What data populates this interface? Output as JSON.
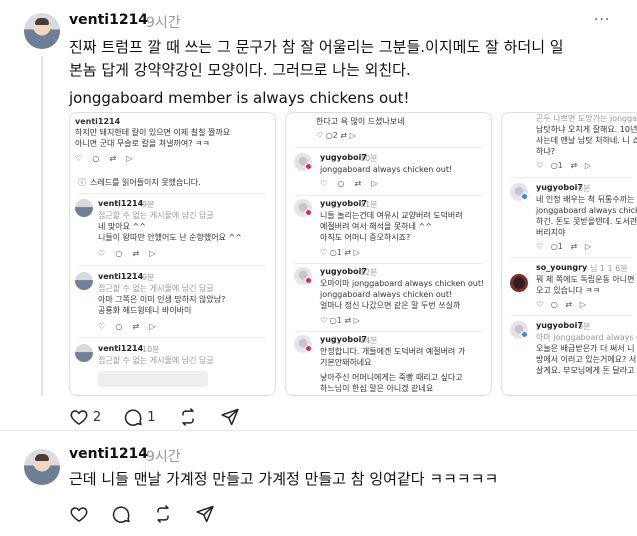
{
  "post1": {
    "username": "venti1214",
    "time": "9시간",
    "more": "···",
    "text_line1": "진짜 트럼프 깔 때 쓰는 그 문구가 참 잘 어울리는 그분들.이지메도 잘 하더니 일",
    "text_line2": "본놈 답게 강약약강인 모양이다. 그러므로 나는 외친다.",
    "text_line3": "jonggaboard member is always chickens out!",
    "likes": "2",
    "comments": "1",
    "screenshots": {
      "card1": {
        "i1_name": "venti1214",
        "i1_l1": "하지만 돼지한테 칼이 있으면 이제 칠칠 짤까요",
        "i1_l2": "아니면 군대 무슬로 칼을 쳐낼까여? ㅋㅋ",
        "i1_notice": "스레드를 읽어들이지 못했습니다.",
        "i2_name": "venti1214",
        "i2_time": "9분",
        "i2_grey": "접근할 수 없는 게시물에 남긴 답글",
        "i2_l1": "네 맞아요 ^^",
        "i2_l2": "니들이 왕따만 안했어도 난 순항했어요 ^^",
        "i3_name": "venti1214",
        "i3_time": "9분",
        "i3_grey": "접근할 수 없는 게시물에 남긴 답글",
        "i3_l1": "아마 그쪽은 이미 인생 망하지 않았남?",
        "i3_l2": "공룡화 헤드윙테니 바이바이",
        "i4_name": "venti1214",
        "i4_time": "10분",
        "i4_grey": "접근할 수 없는 게시물에 남긴 답글"
      },
      "card2": {
        "top_l1": "한다고 욕 많이 드셨나보네",
        "top_icons": "♡  ○2  ⇄  ▷",
        "i1_name": "yugyoboi7",
        "i1_time": "10분",
        "i1_l1": "jonggaboard always chicken out!",
        "i2_name": "yugyoboi7",
        "i2_time": "11분",
        "i2_l1": "니들 놀리는건데 여유시 교양버려 도덕버려",
        "i2_l2": "예절버려 여서 해석을 못하네 ^^",
        "i2_l3": "아직도 어머니 증오하시죠?",
        "i2_icons": "♡  ○1  ⇄  ▷",
        "i3_name": "yugyoboi7",
        "i3_time": "12분",
        "i3_l1": "오마이마 jonggaboard always chicken out!",
        "i3_l2": "jonggaboard always chicken out!",
        "i3_l3": "얼마나 정신 나갔으면 같은 말 두번 쓰실까",
        "i3_icons": "♡  ○1  ⇄  ▷",
        "i4_name": "yugyoboi7",
        "i4_time": "14분",
        "i4_l1": "안정합니다. 개들에겐 도덕버려 예절버려 가",
        "i4_l2": "기본안돼하네요",
        "i4_l3": "낳아주신 어머니에게는 죽빵 때리고 싶다고",
        "i4_l4": "하느님이 한심 말은 아니겠 같네요"
      },
      "card3": {
        "i0_l1": "곤두 나쁘면 도망가는 jonggaboard",
        "i0_l2": "남탓하냐 오지게 잘해요. 10년",
        "i0_l3": "사는데 맨날 남탓 처하네. 니 쇼",
        "i0_l4": "하냐?",
        "i1_name": "yugyoboi7",
        "i1_time": "6분",
        "i1_l1": "네 인정 배우는 척 뒤통수까는",
        "i1_l2": "jonggaboard always chicken",
        "i1_l3": "하긴. 돈도 못받을텐데. 도서관",
        "i1_l4": "버리지야",
        "i2_name": "so_youngry",
        "i2_time": "님 1 1 6분",
        "i2_l1": "뭐 제 쪽에도 독립운동 아니면",
        "i2_l2": "오고 있습니다 ㅋㅋ",
        "i3_name": "yugyoboi7",
        "i3_time": "5분",
        "i3_l1": "아마 jonggaboard always ch",
        "i3_l2": "오늘은 배급받은가 더 써서 니",
        "i3_l3": "방에서 이러고 있는거에요? 서",
        "i3_l4": "살게요. 부모님에게 돈 달라고"
      }
    }
  },
  "post2": {
    "username": "venti1214",
    "time": "9시간",
    "text": "근데 니들 맨날 가계정 만들고 가계정 만들고 참 잉여같다 ㅋㅋㅋㅋㅋ"
  }
}
